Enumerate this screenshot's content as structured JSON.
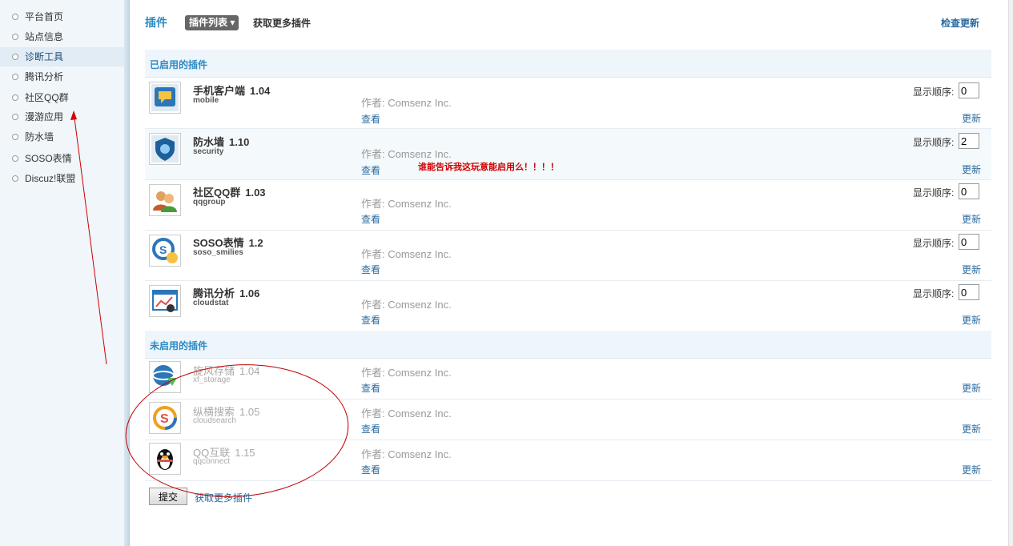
{
  "sidebar": {
    "items": [
      {
        "label": "平台首页"
      },
      {
        "label": "站点信息"
      },
      {
        "label": "诊断工具"
      },
      {
        "label": "腾讯分析"
      },
      {
        "label": "社区QQ群"
      },
      {
        "label": "漫游应用"
      },
      {
        "label": "防水墙"
      },
      {
        "label": "SOSO表情"
      },
      {
        "label": "Discuz!联盟"
      }
    ],
    "active_index": 2
  },
  "header": {
    "title": "插件",
    "list_button": "插件列表 ▾",
    "more_plugins": "获取更多插件",
    "check_update": "检查更新"
  },
  "enabled_section": {
    "title": "已启用的插件",
    "order_label": "显示顺序:",
    "plugins": [
      {
        "name": "手机客户端",
        "version": "1.04",
        "id": "mobile",
        "author": "作者: Comsenz Inc.",
        "view": "查看",
        "update": "更新",
        "order": "0"
      },
      {
        "name": "防水墙",
        "version": "1.10",
        "id": "security",
        "author": "作者: Comsenz Inc.",
        "view": "查看",
        "update": "更新",
        "order": "2"
      },
      {
        "name": "社区QQ群",
        "version": "1.03",
        "id": "qqgroup",
        "author": "作者: Comsenz Inc.",
        "view": "查看",
        "update": "更新",
        "order": "0"
      },
      {
        "name": "SOSO表情",
        "version": "1.2",
        "id": "soso_smilies",
        "author": "作者: Comsenz Inc.",
        "view": "查看",
        "update": "更新",
        "order": "0"
      },
      {
        "name": "腾讯分析",
        "version": "1.06",
        "id": "cloudstat",
        "author": "作者: Comsenz Inc.",
        "view": "查看",
        "update": "更新",
        "order": "0"
      }
    ]
  },
  "disabled_section": {
    "title": "未启用的插件",
    "plugins": [
      {
        "name": "旋风存储",
        "version": "1.04",
        "id": "xf_storage",
        "author": "作者: Comsenz Inc.",
        "view": "查看",
        "update": "更新"
      },
      {
        "name": "纵横搜索",
        "version": "1.05",
        "id": "cloudsearch",
        "author": "作者: Comsenz Inc.",
        "view": "查看",
        "update": "更新"
      },
      {
        "name": "QQ互联",
        "version": "1.15",
        "id": "qqconnect",
        "author": "作者: Comsenz Inc.",
        "view": "查看",
        "update": "更新"
      }
    ]
  },
  "footer": {
    "submit": "提交",
    "more_plugins": "获取更多插件"
  },
  "annotation": {
    "note": "谁能告诉我这玩意能启用么！！！！",
    "color": "#d00000"
  }
}
